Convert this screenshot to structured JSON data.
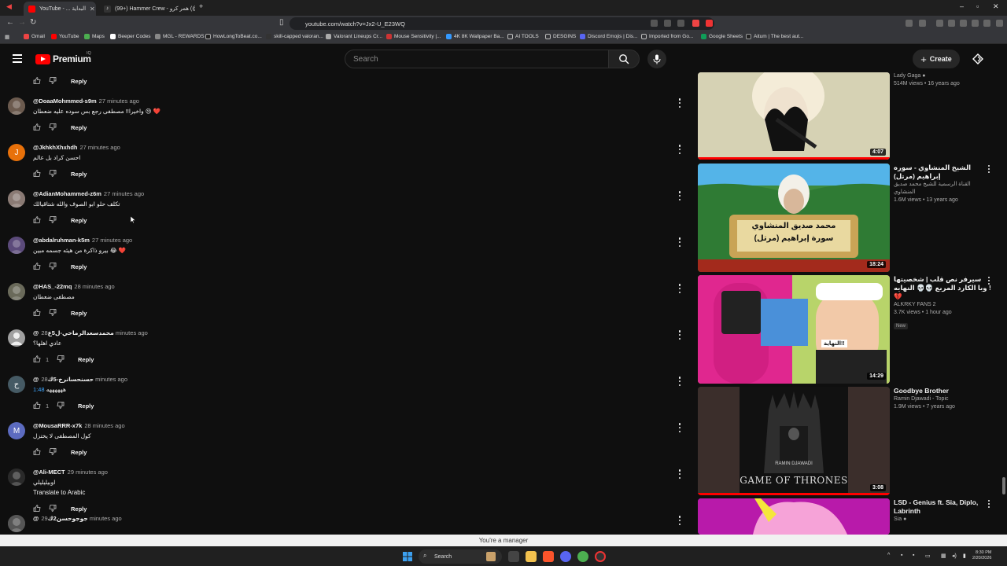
{
  "browser": {
    "tabs": [
      {
        "title": "YouTube - ... البداية",
        "active": true
      },
      {
        "title": "(99+) Hammer Crew - همر كرو (@hm...",
        "active": false
      }
    ],
    "url": "youtube.com/watch?v=Jx2-U_E23WQ",
    "bookmarks": [
      "Gmail",
      "YouTube",
      "Maps",
      "Beeper Codes",
      "MGL - REWARDS",
      "HowLongToBeat.co...",
      "skill-capped valoran...",
      "Valorant Lineups Cr...",
      "Mouse Sensitivity |...",
      "4K 8K Wallpaper Ba...",
      "AI TOOLS",
      "DESGINS",
      "Discord Emojis | Dis...",
      "Imported from Go...",
      "Google Sheets",
      "Aitum | The best aut..."
    ]
  },
  "header": {
    "logo_text": "Premium",
    "logo_sup": "IQ",
    "search_placeholder": "Search",
    "create_label": "Create"
  },
  "top_reply": "Reply",
  "comments": [
    {
      "handle": "@DoaaMohmmed-s9m",
      "time": "27 minutes ago",
      "text": "واخيرا!! مصطفى رجع بس سوده عليه ضعطان 😢 ❤️",
      "likes": "",
      "reply": "Reply",
      "avatar": "photo",
      "avatar_color": "#6b5a4e"
    },
    {
      "handle": "@JkhkhXhxhdh",
      "time": "27 minutes ago",
      "text": "احسن كراد بل عالم",
      "likes": "",
      "reply": "Reply",
      "avatar": "J",
      "avatar_color": "#e8710a"
    },
    {
      "handle": "@AdianMohammed-z6m",
      "time": "27 minutes ago",
      "text": "تكلف حلو ابو الصوف والله شتاقيالك",
      "likes": "",
      "reply": "Reply",
      "avatar": "photo",
      "avatar_color": "#8a7a74"
    },
    {
      "handle": "@abdalruhman-k5m",
      "time": "27 minutes ago",
      "text": "بيرو ذاكرة من هيئه جسمه مبين 😂 ❤️",
      "likes": "",
      "reply": "Reply",
      "avatar": "photo",
      "avatar_color": "#5b4a7a"
    },
    {
      "handle": "@HAS_-22mq",
      "time": "28 minutes ago",
      "text": "مصطفى ضعطان",
      "likes": "",
      "reply": "Reply",
      "avatar": "photo",
      "avatar_color": "#6a6a5a"
    },
    {
      "handle": "@محمدسعدالرماحي-ل5ع",
      "time": "28 minutes ago",
      "text": "عادي اهلها؟",
      "likes": "1",
      "reply": "Reply",
      "avatar": "person",
      "avatar_color": "#a0a0a0"
    },
    {
      "handle": "@حسنحسانرخ-5ك",
      "time": "28 minutes ago",
      "text": "ههههههه",
      "timestamp": "1:48",
      "likes": "1",
      "reply": "Reply",
      "avatar": "ح",
      "avatar_color": "#455a64"
    },
    {
      "handle": "@MousaRRR-x7k",
      "time": "28 minutes ago",
      "text": "كول المصطفى لا يختزل",
      "likes": "",
      "reply": "Reply",
      "avatar": "M",
      "avatar_color": "#5c6bc0"
    },
    {
      "handle": "@Ali-MECT",
      "time": "29 minutes ago",
      "text": "اوبيليليلي",
      "translate": "Translate to Arabic",
      "likes": "",
      "reply": "Reply",
      "avatar": "photo",
      "avatar_color": "#2a2a2a"
    },
    {
      "handle": "@جوجوحسن2ك",
      "time": "29 minutes ago",
      "text": "",
      "likes": "",
      "reply": "",
      "avatar": "photo",
      "avatar_color": "#555"
    }
  ],
  "videos": [
    {
      "title": "",
      "channel": "Lady Gaga",
      "verified": true,
      "meta": "514M views • 16 years ago",
      "duration": "4:07",
      "watched": true,
      "thumb_bg": "#c9c4a0"
    },
    {
      "title": "الشيخ المنشاوي - سوره إبراهيم (مرتل)",
      "channel": "القناة الرسمية للشيخ محمد صديق المنشاوي",
      "verified": false,
      "meta": "1.6M views • 13 years ago",
      "duration": "18:24",
      "watched": false,
      "thumb_bg": "#3f8a3a",
      "thumb_title": "محمد صديق المنشاوي",
      "thumb_sub": "سورة إبراهيم (مرتل)"
    },
    {
      "title": "سيرفر نص قلب | شخصيتها وبا الكارد المربع 💀💀 النهايه ! 💔",
      "channel": "ALKRKY FANS 2",
      "verified": false,
      "meta": "3.7K views • 1 hour ago",
      "badge": "New",
      "duration": "14:29",
      "watched": false,
      "thumb_bg": "#d6278f",
      "thumb_label": "النهاية!!"
    },
    {
      "title": "Goodbye Brother",
      "channel": "Ramin Djawadi - Topic",
      "verified": false,
      "meta": "1.9M views • 7 years ago",
      "duration": "3:08",
      "watched": true,
      "thumb_bg": "#3a2f2c",
      "thumb_art_top": "RAMIN DJAWADI",
      "thumb_art": "GAME OF THRONES"
    },
    {
      "title": "LSD - Genius ft. Sia, Diplo, Labrinth",
      "channel": "Sia",
      "verified": true,
      "meta": "",
      "duration": "",
      "watched": false,
      "thumb_bg": "#c21bb0"
    }
  ],
  "manager_banner": "You're a manager",
  "taskbar": {
    "search_label": "Search",
    "time": "8:30 PM",
    "date": "2/20/2026"
  },
  "colors": {
    "brand": "#ff0000",
    "bg": "#0f0f0f",
    "link": "#3ea6ff"
  }
}
